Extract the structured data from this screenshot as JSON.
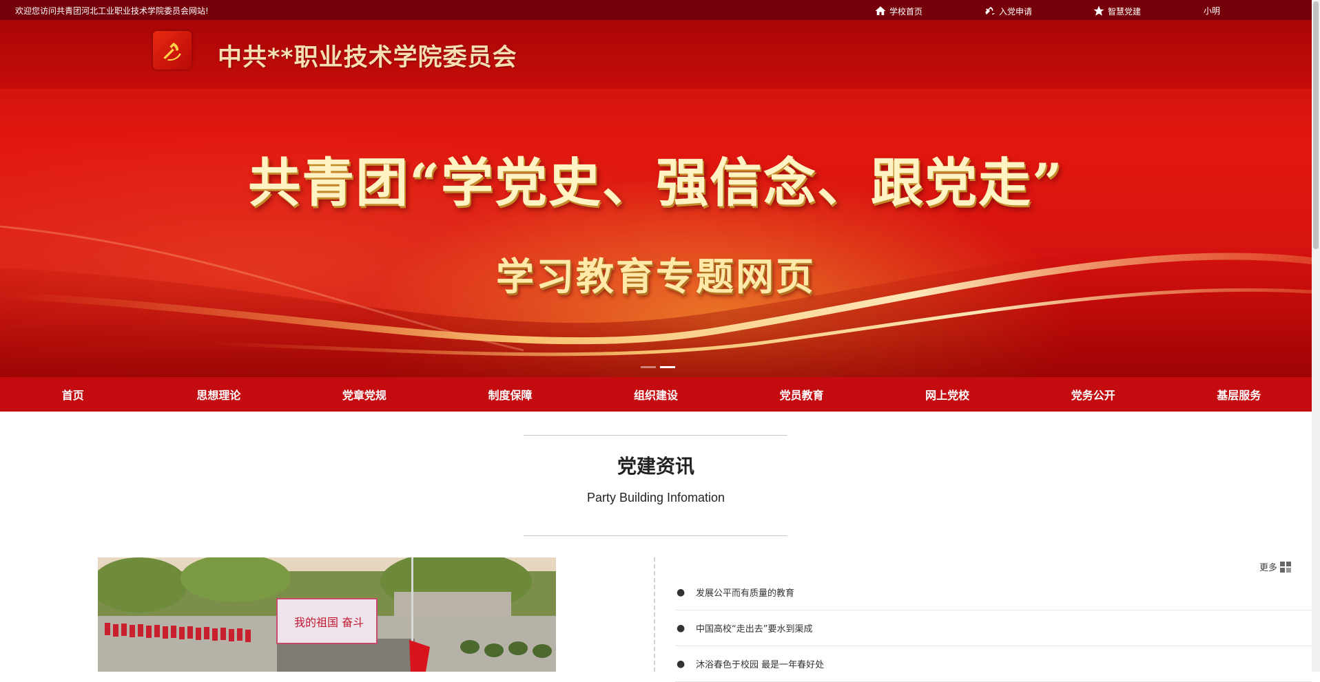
{
  "topbar": {
    "welcome": "欢迎您访问共青团河北工业职业技术学院委员会网站!",
    "links": [
      {
        "label": "学校首页",
        "icon": "home-icon"
      },
      {
        "label": "入党申请",
        "icon": "party-emblem-icon"
      },
      {
        "label": "智慧党建",
        "icon": "star-icon"
      }
    ],
    "user": "小明"
  },
  "header": {
    "site_title": "中共**职业技术学院委员会",
    "banner_line1": "共青团“学党史、强信念、跟党走”",
    "banner_line2": "学习教育专题网页"
  },
  "nav": {
    "items": [
      "首页",
      "思想理论",
      "党章党规",
      "制度保障",
      "组织建设",
      "党员教育",
      "网上党校",
      "党务公开",
      "基层服务"
    ]
  },
  "section": {
    "title": "党建资讯",
    "subtitle": "Party Building Infomation",
    "more": "更多"
  },
  "news": [
    {
      "bullet": "●",
      "title": "发展公平而有质量的教育"
    },
    {
      "bullet": "●",
      "title": "中国高校“走出去”要水到渠成"
    },
    {
      "bullet": "●",
      "title": "沐浴春色于校园 最是一年春好处"
    }
  ],
  "photo": {
    "banner_text": "我的祖国 奋斗"
  },
  "colors": {
    "topbar": "#760009",
    "nav": "#c40b10",
    "banner": "#e2170f"
  }
}
